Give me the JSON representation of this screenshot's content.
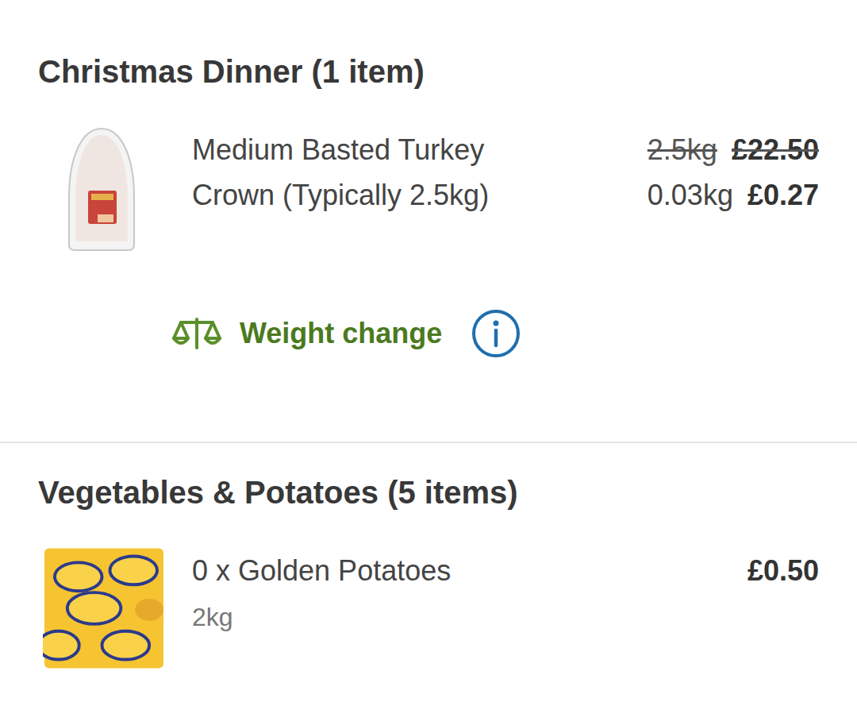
{
  "sections": [
    {
      "title": "Christmas Dinner (1 item)",
      "items": [
        {
          "kind": "weighted",
          "name": "Medium Basted Turkey Crown (Typically 2.5kg)",
          "old_weight": "2.5kg",
          "old_price": "£22.50",
          "weight": "0.03kg",
          "price": "£0.27",
          "note": "Weight change"
        }
      ]
    },
    {
      "title": "Vegetables & Potatoes (5 items)",
      "items": [
        {
          "kind": "quantity",
          "name": "0 x Golden Potatoes",
          "size": "2kg",
          "price": "£0.50"
        }
      ]
    }
  ]
}
